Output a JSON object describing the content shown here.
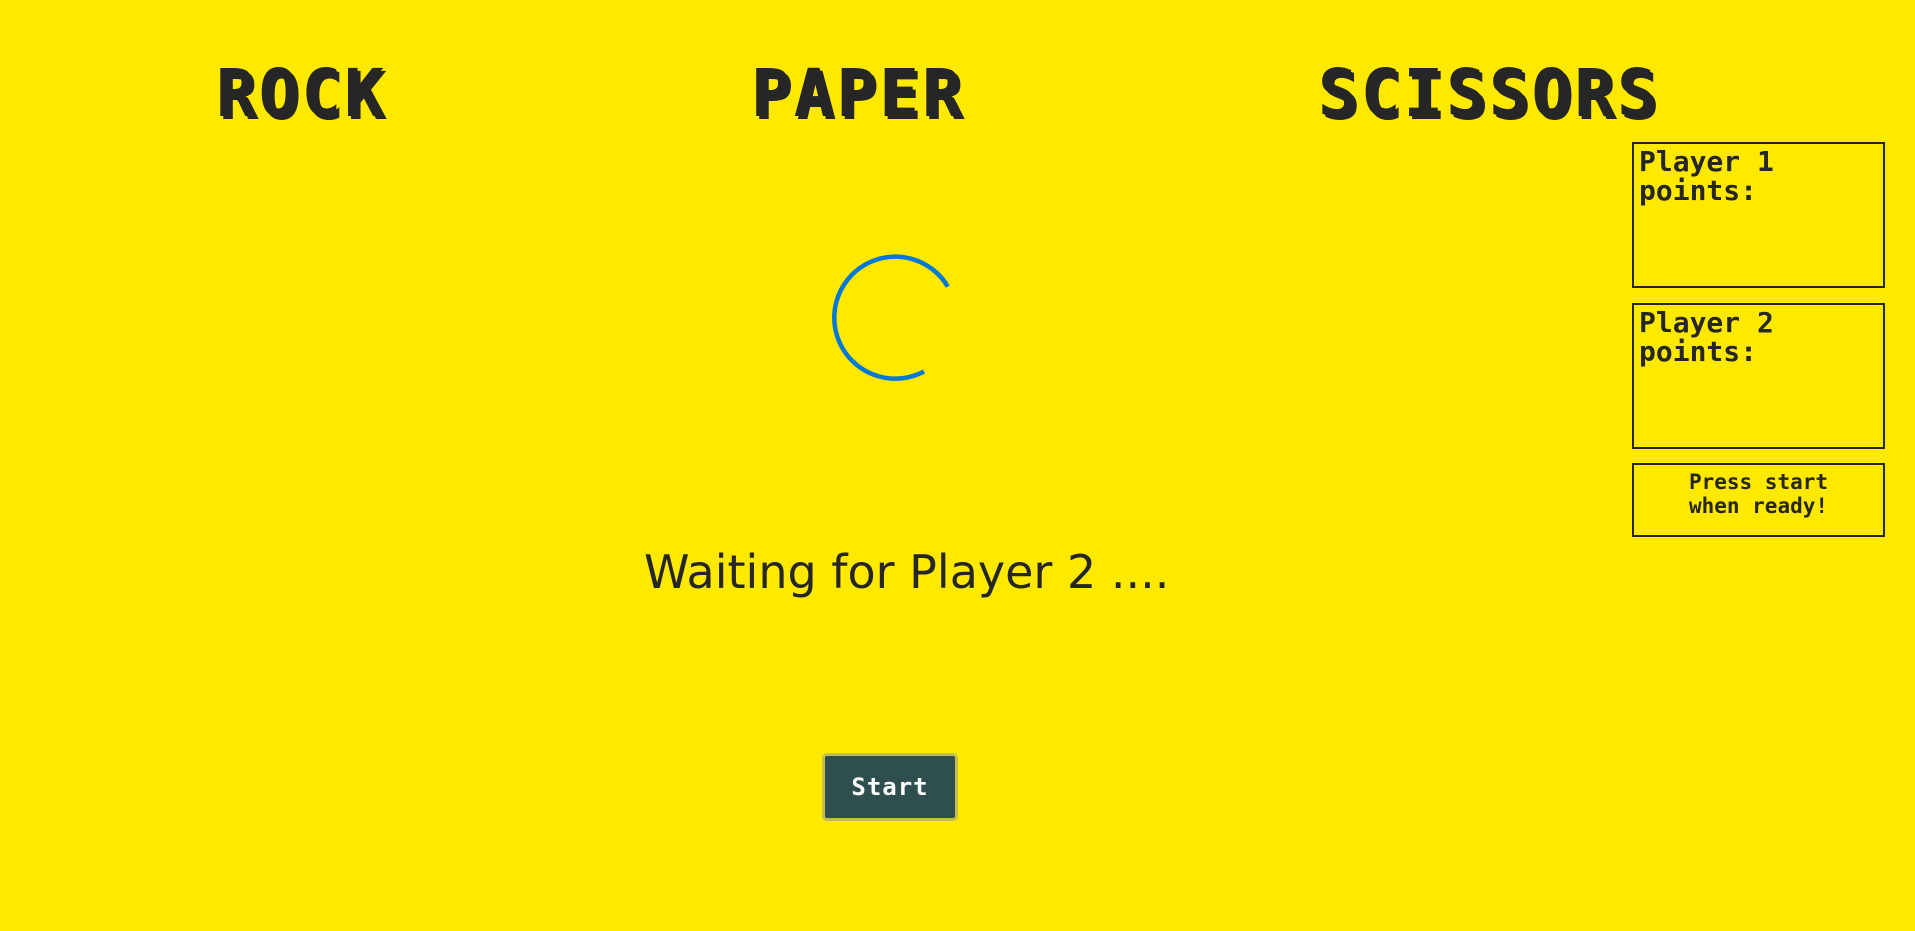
{
  "title": {
    "rock": "ROCK",
    "paper": "PAPER",
    "scissors": "SCISSORS"
  },
  "status": {
    "waiting_text": "Waiting for Player 2 ...."
  },
  "controls": {
    "start_label": "Start"
  },
  "scoreboard": {
    "player1": {
      "line1": "Player 1",
      "line2": "points:",
      "points": ""
    },
    "player2": {
      "line1": "Player 2",
      "line2": "points:",
      "points": ""
    },
    "message": {
      "line1": "Press start",
      "line2": "when ready!"
    }
  },
  "colors": {
    "background": "#ffe900",
    "text": "#262626",
    "spinner": "#0078d7",
    "button_bg": "#2f4f4f",
    "button_text": "#ffffff"
  },
  "icons": {
    "spinner": "loading-spinner-icon"
  }
}
